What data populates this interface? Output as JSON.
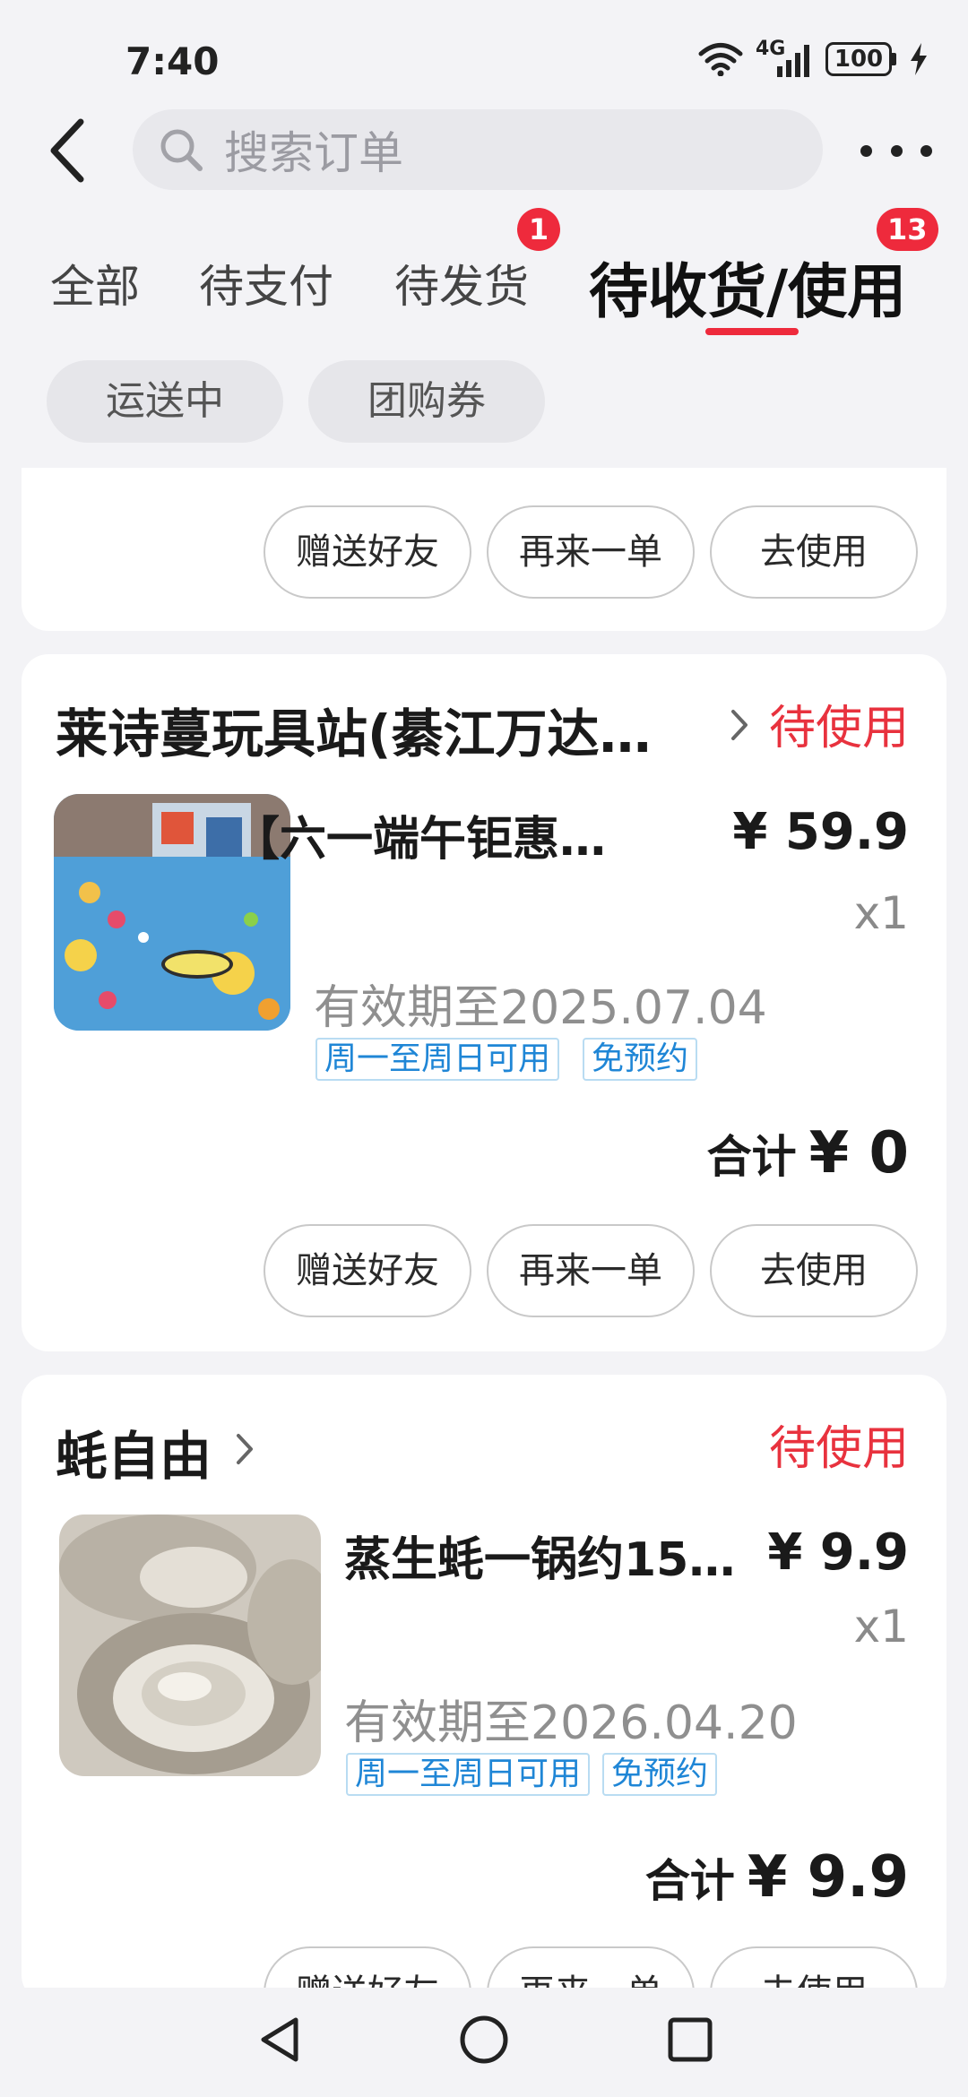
{
  "status_bar": {
    "time": "7:40",
    "network": "4G",
    "battery": "100"
  },
  "header": {
    "search_placeholder": "搜索订单"
  },
  "tabs": [
    {
      "label": "全部",
      "badge": null
    },
    {
      "label": "待支付",
      "badge": null
    },
    {
      "label": "待发货",
      "badge": "1"
    },
    {
      "label": "待收货/使用",
      "badge": "13",
      "active": true
    }
  ],
  "sub_filters": [
    "运送中",
    "团购券"
  ],
  "colors": {
    "accent": "#ee2a3c",
    "status_red": "#e8323e",
    "tag_blue": "#1f86d6",
    "page_bg": "#f3f3f6"
  },
  "cards": [
    {
      "buttons": [
        "赠送好友",
        "再来一单",
        "去使用"
      ]
    },
    {
      "shop": "莱诗蔓玩具站(綦江万达…",
      "status": "待使用",
      "product": "【六一端午钜惠…",
      "price": "¥ 59.9",
      "qty": "x1",
      "validity": "有效期至2025.07.04",
      "tags": [
        "周一至周日可用",
        "免预约"
      ],
      "total_label": "合计",
      "total_amount": "¥ 0",
      "buttons": [
        "赠送好友",
        "再来一单",
        "去使用"
      ]
    },
    {
      "shop": "蚝自由",
      "status": "待使用",
      "product": "蒸生蚝一锅约15…",
      "price": "¥ 9.9",
      "qty": "x1",
      "validity": "有效期至2026.04.20",
      "tags": [
        "周一至周日可用",
        "免预约"
      ],
      "total_label": "合计",
      "total_amount": "¥ 9.9",
      "buttons": [
        "赠送好友",
        "再来一单",
        "去使用"
      ]
    }
  ]
}
